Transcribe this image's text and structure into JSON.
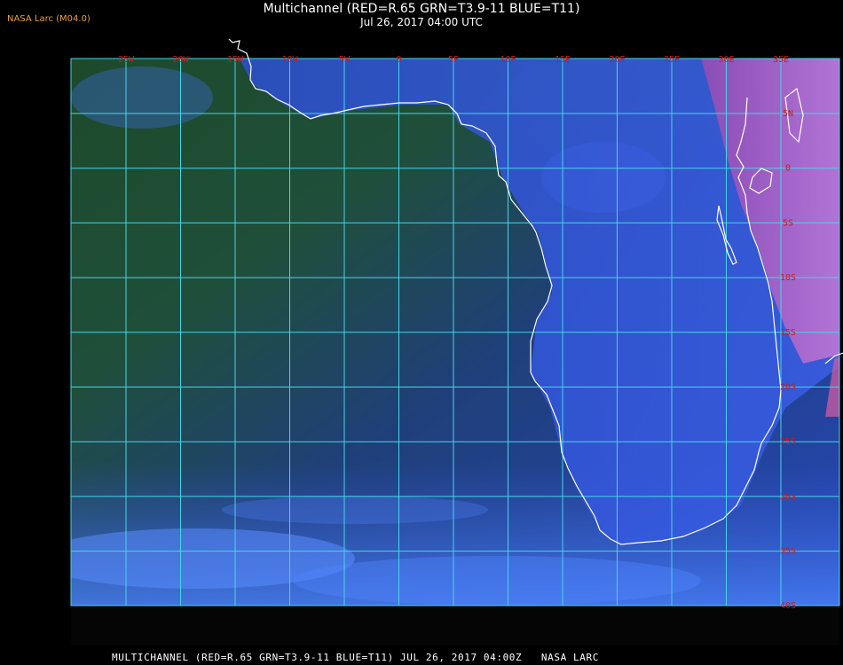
{
  "header": {
    "brand": "NASA Larc (M04.0)",
    "title": "Multichannel (RED=R.65 GRN=T3.9-11 BLUE=T11)",
    "subtitle": "Jul 26, 2017 04:00 UTC"
  },
  "footer": {
    "caption": "MULTICHANNEL (RED=R.65 GRN=T3.9-11 BLUE=T11) JUL 26, 2017 04:00Z   NASA LARC"
  },
  "map": {
    "grid_color": "#44d6e8",
    "label_color": "#cc1a1a",
    "coast_color": "#ffffff",
    "longitude_labels": [
      "25W",
      "20W",
      "15W",
      "10W",
      "5W",
      "0",
      "5E",
      "10E",
      "15E",
      "20E",
      "25E",
      "30E",
      "35E"
    ],
    "latitude_labels": [
      "5N",
      "0",
      "5S",
      "10S",
      "15S",
      "20S",
      "25S",
      "30S",
      "35S",
      "40S"
    ]
  }
}
